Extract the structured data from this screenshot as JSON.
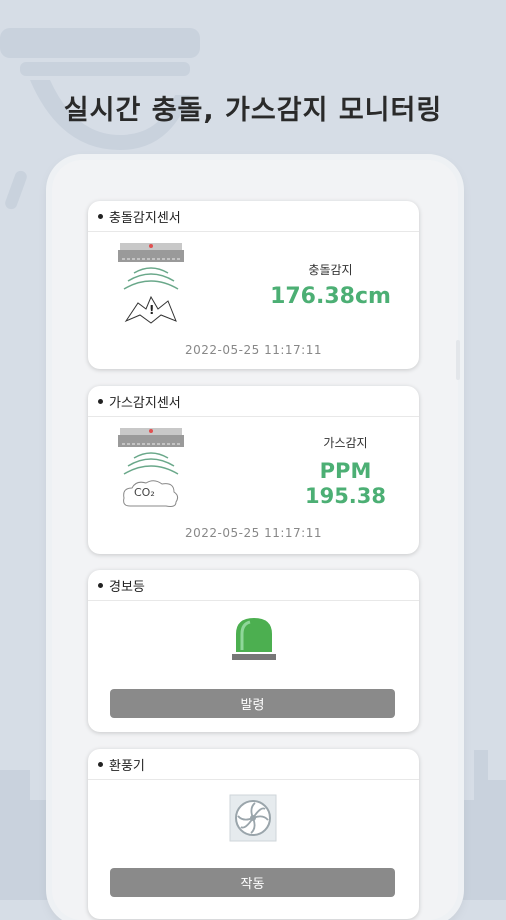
{
  "headline": "실시간 충돌, 가스감지 모니터링",
  "cards": [
    {
      "title": "충돌감지센서",
      "metric_label": "충돌감지",
      "metric_value": "176.38cm",
      "timestamp": "2022-05-25 11:17:11",
      "icon": "collision-sensor-icon"
    },
    {
      "title": "가스감지센서",
      "metric_label": "가스감지",
      "metric_unit": "PPM",
      "metric_value": "195.38",
      "timestamp": "2022-05-25 11:17:11",
      "icon": "gas-sensor-icon",
      "gas_label": "CO₂"
    },
    {
      "title": "경보등",
      "button_label": "발령",
      "icon": "warning-light-icon",
      "light_color": "#4caf50"
    },
    {
      "title": "환풍기",
      "button_label": "작동",
      "icon": "fan-icon"
    }
  ],
  "colors": {
    "accent": "#4caf74",
    "button": "#8a8a8a",
    "background": "#d6dde6"
  }
}
